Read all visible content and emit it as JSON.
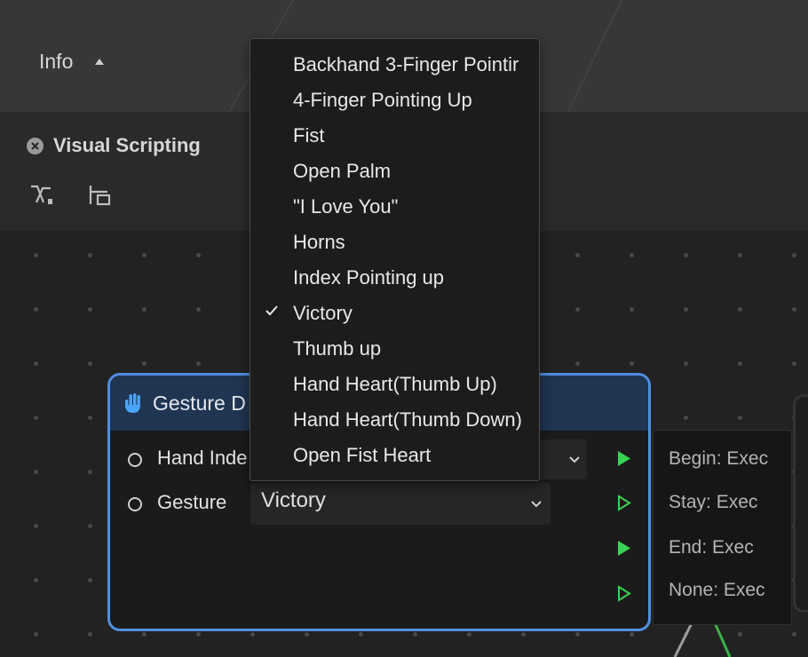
{
  "header": {
    "info_label": "Info"
  },
  "panel": {
    "title": "Visual Scripting",
    "tools": [
      "connector-tool-icon",
      "frame-tool-icon"
    ]
  },
  "node": {
    "title": "Gesture D",
    "rows": [
      {
        "label": "Hand Inde",
        "value": ""
      },
      {
        "label": "Gesture",
        "value": "Victory"
      }
    ],
    "outputs": [
      {
        "label": "Begin: Exec",
        "connected": true
      },
      {
        "label": "Stay: Exec",
        "connected": false
      },
      {
        "label": "End: Exec",
        "connected": true
      },
      {
        "label": "None: Exec",
        "connected": false
      }
    ]
  },
  "dropdown": {
    "selected": "Victory",
    "items": [
      "Backhand 3-Finger Pointir",
      "4-Finger Pointing Up",
      "Fist",
      "Open Palm",
      "\"I Love You\"",
      "Horns",
      "Index Pointing up",
      "Victory",
      "Thumb up",
      "Hand Heart(Thumb Up)",
      "Hand Heart(Thumb Down)",
      "Open Fist Heart"
    ]
  },
  "colors": {
    "node_border": "#4f8fe0",
    "node_header": "#203552",
    "exec_port": "#39d353",
    "hand_icon": "#4aa3ff"
  }
}
